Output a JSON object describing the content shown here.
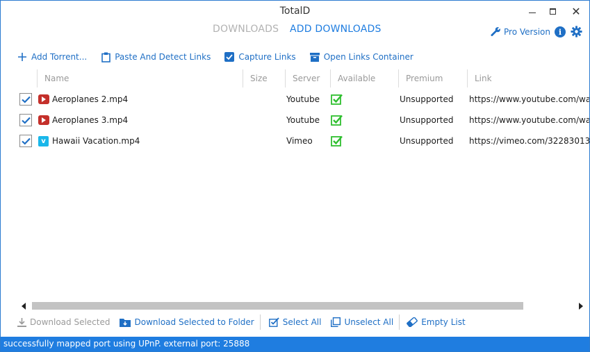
{
  "window": {
    "title": "TotalD"
  },
  "tabs": [
    {
      "label": "DOWNLOADS",
      "active": false
    },
    {
      "label": "ADD DOWNLOADS",
      "active": true
    }
  ],
  "header": {
    "pro_label": "Pro Version"
  },
  "toolbar": {
    "add_torrent": "Add Torrent...",
    "paste_detect": "Paste And Detect Links",
    "capture_links": "Capture Links",
    "open_container": "Open Links Container"
  },
  "table": {
    "columns": [
      "Name",
      "Size",
      "Server",
      "Available",
      "Premium",
      "Link"
    ],
    "rows": [
      {
        "checked": true,
        "service_icon": "youtube-icon",
        "name": "Aeroplanes 2.mp4",
        "size": "",
        "server": "Youtube",
        "available": true,
        "premium": "Unsupported",
        "link": "https://www.youtube.com/watch"
      },
      {
        "checked": true,
        "service_icon": "youtube-icon",
        "name": "Aeroplanes 3.mp4",
        "size": "",
        "server": "Youtube",
        "available": true,
        "premium": "Unsupported",
        "link": "https://www.youtube.com/watch"
      },
      {
        "checked": true,
        "service_icon": "vimeo-icon",
        "name": "Hawaii Vacation.mp4",
        "size": "",
        "server": "Vimeo",
        "available": true,
        "premium": "Unsupported",
        "link": "https://vimeo.com/32283013"
      }
    ]
  },
  "actions": {
    "download_selected": "Download Selected",
    "download_to_folder": "Download Selected to Folder",
    "select_all": "Select All",
    "unselect_all": "Unselect All",
    "empty_list": "Empty List"
  },
  "status": {
    "text": "successfully mapped port using UPnP. external port: 25888"
  },
  "colors": {
    "accent": "#1f7de0",
    "link_blue": "#1f6fc5",
    "available_green": "#2fbf2f",
    "youtube_red": "#c4302b",
    "vimeo_blue": "#1ab7ea"
  }
}
